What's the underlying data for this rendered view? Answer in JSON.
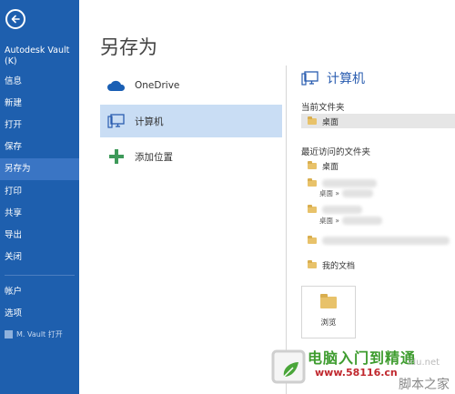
{
  "sidebar": {
    "app_name": "Autodesk Vault (K)",
    "items": [
      {
        "label": "信息",
        "active": false
      },
      {
        "label": "新建",
        "active": false
      },
      {
        "label": "打开",
        "active": false
      },
      {
        "label": "保存",
        "active": false
      },
      {
        "label": "另存为",
        "active": true
      },
      {
        "label": "打印",
        "active": false
      },
      {
        "label": "共享",
        "active": false
      },
      {
        "label": "导出",
        "active": false
      },
      {
        "label": "关闭",
        "active": false
      },
      {
        "label": "帐户",
        "active": false
      },
      {
        "label": "选项",
        "active": false
      }
    ],
    "vault_item": "M. Vault 打开"
  },
  "page_title": "另存为",
  "places": [
    {
      "label": "OneDrive",
      "icon": "cloud-icon",
      "active": false
    },
    {
      "label": "计算机",
      "icon": "computer-icon",
      "active": true
    },
    {
      "label": "添加位置",
      "icon": "plus-icon",
      "active": false
    }
  ],
  "right": {
    "title": "计算机",
    "current_folder_heading": "当前文件夹",
    "current_folder": "桌面",
    "recent_heading": "最近访问的文件夹",
    "recent": [
      {
        "name": "桌面",
        "path": ""
      },
      {
        "name": "",
        "path": "桌面 »"
      },
      {
        "name": "",
        "path": "桌面 »"
      },
      {
        "name": "",
        "path": ""
      },
      {
        "name": "我的文档",
        "path": ""
      }
    ],
    "browse_label": "浏览"
  },
  "watermark": {
    "line1": "电脑入门到精通",
    "line2": "www.58116.cn",
    "line3": "脚本之家",
    "faint": "idu.net"
  },
  "colors": {
    "sidebar_bg": "#1e5fae",
    "sidebar_active": "#3a75c4",
    "place_active": "#c9ddf4",
    "accent_title": "#2a5db0",
    "folder": "#e8c26a"
  }
}
